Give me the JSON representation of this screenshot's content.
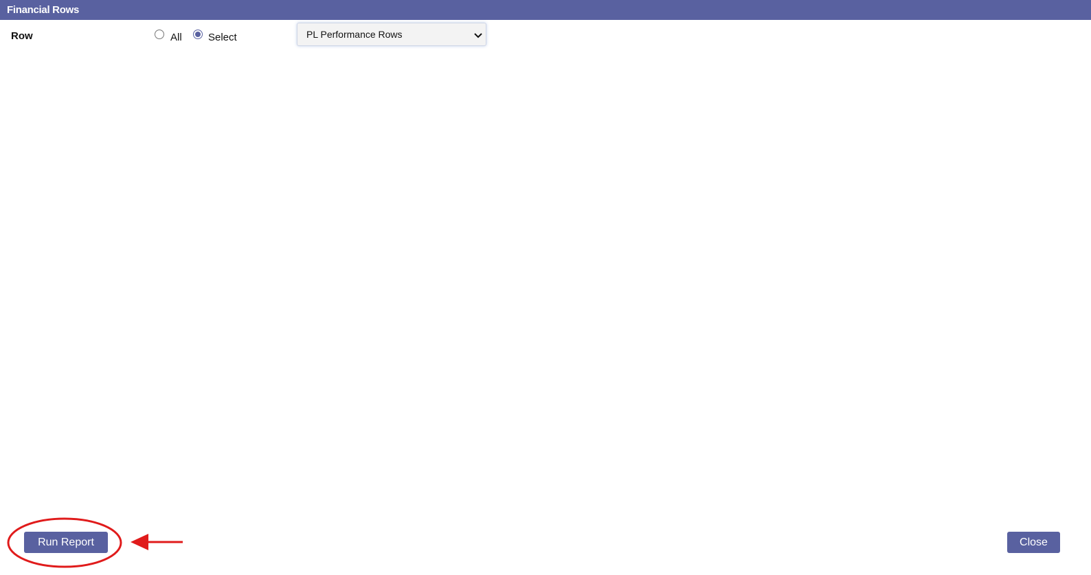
{
  "window": {
    "title": "Financial Rows"
  },
  "form": {
    "row_label": "Row",
    "radio_all_label": "All",
    "radio_select_label": "Select",
    "radio_selected": "Select",
    "row_select_value": "PL Performance Rows"
  },
  "footer": {
    "run_report_label": "Run Report",
    "close_label": "Close"
  },
  "colors": {
    "accent": "#5961a0",
    "annotation": "#e01b1b"
  },
  "icons": {
    "dropdown": "chevron-down-icon"
  }
}
